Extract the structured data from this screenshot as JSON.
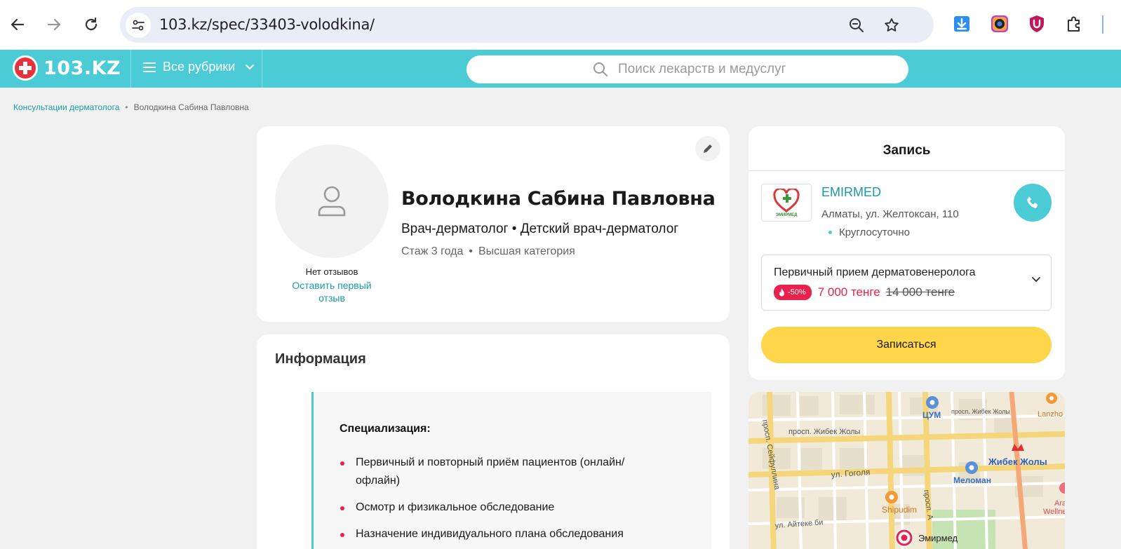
{
  "browser": {
    "url": "103.kz/spec/33403-volodkina/"
  },
  "header": {
    "logo_text": "103.KZ",
    "rubrics_label": "Все рубрики",
    "search_placeholder": "Поиск лекарств и медуслуг"
  },
  "breadcrumbs": [
    {
      "label": "Консультации дерматолога"
    },
    {
      "label": "Володкина Сабина Павловна"
    }
  ],
  "profile": {
    "name": "Володкина Сабина Павловна",
    "specialties": "Врач-дерматолог • Детский врач-дерматолог",
    "experience": "Стаж 3 года",
    "category": "Высшая категория",
    "no_reviews": "Нет отзывов",
    "leave_review": "Оставить первый отзыв"
  },
  "info": {
    "title": "Информация",
    "spec_title": "Специализация:",
    "items": [
      "Первичный и повторный приём пациентов (онлайн/офлайн)",
      "Осмотр и физикальное обследование",
      "Назначение индивидуального плана обследования"
    ]
  },
  "booking": {
    "title": "Запись",
    "clinic": {
      "name": "EMIRMED",
      "logo_text": "ЭМИРМЕД",
      "address": "Алматы, ул. Желтоксан, 110",
      "hours": "Круглосуточно"
    },
    "service": {
      "name": "Первичный прием дерматовенеролога",
      "discount": "-50%",
      "price": "7 000 тенге",
      "old_price": "14 000 тенге"
    },
    "button_label": "Записаться"
  },
  "map": {
    "labels": {
      "street_zhibek": "просп. Жибек Жолы",
      "street_zhibek_right": "просп. Жибек Жолы",
      "street_seifullin": "просп. Сейфуллина",
      "street_gogol": "ул. Гоголя",
      "street_aiteke": "ул. Айтеке би",
      "street_ablai": "просп. А",
      "tsum": "ЦУМ",
      "zhibek_metro": "Жибек Жолы",
      "meloman": "Меломан",
      "shipudim": "Shipudim",
      "emirmed": "Эмирмед",
      "lanzhou": "Lanzho",
      "wellness_1": "Ara",
      "wellness_2": "Wellne"
    }
  },
  "colors": {
    "brand": "#4acbd6",
    "link": "#1a9ba6",
    "accent_red": "#e8214d",
    "button_yellow": "#ffd54a"
  }
}
